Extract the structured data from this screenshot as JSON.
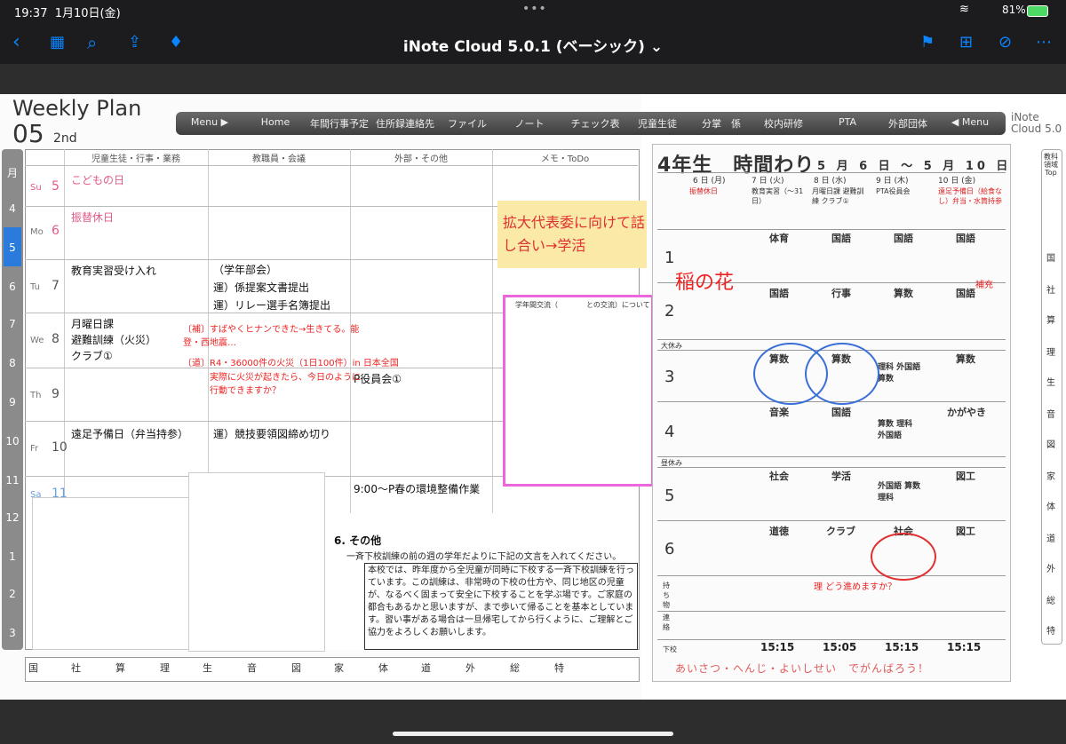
{
  "status": {
    "time": "19:37",
    "date": "1月10日(金)",
    "battery": "81%"
  },
  "app": {
    "title": "iNote Cloud 5.0.1 (ベーシック) ⌄"
  },
  "header": {
    "title": "Weekly Plan",
    "week_number": "05",
    "week_suffix": "2nd",
    "logo": "iNote Cloud 5.0"
  },
  "menu": [
    "Menu ▶",
    "Home",
    "年間行事予定",
    "住所録連絡先",
    "ファイル",
    "ノート",
    "チェック表",
    "児童生徒",
    "分掌　係",
    "校内研修",
    "PTA",
    "外部団体",
    "◀ Menu"
  ],
  "months": [
    "月",
    "4",
    "5",
    "6",
    "7",
    "8",
    "9",
    "10",
    "11",
    "12",
    "1",
    "2",
    "3"
  ],
  "columns": [
    "児童生徒・行事・業務",
    "教職員・会議",
    "外部・その他",
    "メモ・ToDo"
  ],
  "days": [
    {
      "name": "Su",
      "num": "5",
      "event": "こどもの日",
      "staff": "",
      "other": ""
    },
    {
      "name": "Mo",
      "num": "6",
      "event": "振替休日",
      "staff": "",
      "other": ""
    },
    {
      "name": "Tu",
      "num": "7",
      "event": "教育実習受け入れ",
      "staff": "（学年部会）\n運）係提案文書提出\n運）リレー選手名簿提出",
      "other": ""
    },
    {
      "name": "We",
      "num": "8",
      "event": "月曜日課\n避難訓練（火災）\nクラブ①",
      "staff": "",
      "other": ""
    },
    {
      "name": "Th",
      "num": "9",
      "event": "",
      "staff": "",
      "other": "P役員会①"
    },
    {
      "name": "Fr",
      "num": "10",
      "event": "遠足予備日（弁当持参）",
      "staff": "運）競技要領図締め切り",
      "other": ""
    },
    {
      "name": "Sa",
      "num": "11",
      "event": "",
      "staff": "",
      "other": "9:00〜P春の環境整備作業"
    }
  ],
  "subjects": [
    "国",
    "社",
    "算",
    "理",
    "生",
    "音",
    "図",
    "家",
    "体",
    "道",
    "外",
    "総",
    "特"
  ],
  "sticky_note": "拡大代表委に向けて話し合い→学活",
  "pink_doc_title": "学年間交流（　　　　との交流）について",
  "notice": {
    "heading": "6. その他",
    "intro": "一斉下校訓練の前の週の学年だよりに下記の文言を入れてください。",
    "body": "本校では、昨年度から全児童が同時に下校する一斉下校訓練を行っています。この訓練は、非常時の下校の仕方や、同じ地区の児童が、なるべく固まって安全に下校することを学ぶ場です。ご家庭の都合もあるかと思いますが、まで歩いて帰ることを基本としています。習い事がある場合は一旦帰宅してから行くように、ご理解とご協力をよろしくお願いします。"
  },
  "timetable": {
    "title": "4年生　時間わり",
    "date_range": "5 月 6 日 〜 5 月 10 日",
    "days": [
      "6 日 (月)",
      "7 日 (火)",
      "8 日 (水)",
      "9 日 (木)",
      "10 日 (金)"
    ],
    "plans": [
      "振替休日",
      "教育実習（〜31日）",
      "月曜日課 避難訓練 クラブ①",
      "PTA役員会",
      "遠足予備日（給食なし）弁当・水筒持参"
    ],
    "periods": [
      {
        "num": "1",
        "subjects": [
          "",
          "体育",
          "国語",
          "国語",
          "国語"
        ]
      },
      {
        "num": "2",
        "subjects": [
          "",
          "国語",
          "行事",
          "算数",
          "国語"
        ]
      },
      {
        "num": "3",
        "subjects": [
          "",
          "算数",
          "算数",
          "理科 外国語 算数",
          "算数"
        ]
      },
      {
        "num": "4",
        "subjects": [
          "",
          "音楽",
          "国語",
          "算数 理科 外国語",
          "かがやき"
        ]
      },
      {
        "num": "5",
        "subjects": [
          "",
          "社会",
          "学活",
          "外国語 算数 理科",
          "図工"
        ]
      },
      {
        "num": "6",
        "subjects": [
          "",
          "道徳",
          "クラブ",
          "社会",
          "図工"
        ]
      }
    ],
    "break_label": "大休み",
    "lunch_label": "昼休み",
    "items_label": "持ち物",
    "contact_label": "連絡",
    "dismiss_label": "下校",
    "times": [
      "15:15",
      "15:05",
      "15:15",
      "15:15"
    ],
    "footer": "あいさつ・へんじ・よいしせい　でがんばろう！"
  },
  "right_index": [
    "教科領域Top",
    "国",
    "社",
    "算",
    "理",
    "生",
    "音",
    "図",
    "家",
    "体",
    "道",
    "外",
    "総",
    "特"
  ],
  "colors": {
    "accent": "#0a84ff",
    "month_active": "#2a7bdc",
    "handwriting": "#e02020",
    "sticky": "#fbe9a8"
  }
}
